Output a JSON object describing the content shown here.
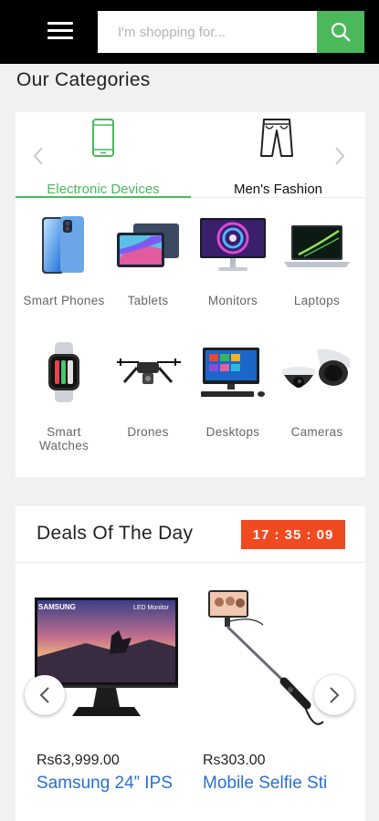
{
  "header": {
    "search_placeholder": "I'm shopping for...",
    "accent_color": "#4cb85c"
  },
  "categories": {
    "title": "Our Categories",
    "tabs": [
      {
        "label": "Electronic Devices",
        "icon": "smartphone-icon",
        "active": true
      },
      {
        "label": "Men's Fashion",
        "icon": "trousers-icon",
        "active": false
      }
    ],
    "items": [
      {
        "label": "Smart Phones",
        "icon": "smartphone-image"
      },
      {
        "label": "Tablets",
        "icon": "tablet-image"
      },
      {
        "label": "Monitors",
        "icon": "monitor-image"
      },
      {
        "label": "Laptops",
        "icon": "laptop-image"
      },
      {
        "label": "Smart Watches",
        "icon": "smartwatch-image"
      },
      {
        "label": "Drones",
        "icon": "drone-image"
      },
      {
        "label": "Desktops",
        "icon": "desktop-image"
      },
      {
        "label": "Cameras",
        "icon": "cctv-camera-image"
      }
    ]
  },
  "deals": {
    "title": "Deals Of The Day",
    "timer": "17 : 35 : 09",
    "timer_color": "#f04a20",
    "products": [
      {
        "price": "Rs63,999.00",
        "name": "Samsung 24” IPS",
        "brand_text": "SAMSUNG",
        "badge_text": "LED Monitor"
      },
      {
        "price": "Rs303.00",
        "name": "Mobile Selfie Sti"
      }
    ]
  }
}
